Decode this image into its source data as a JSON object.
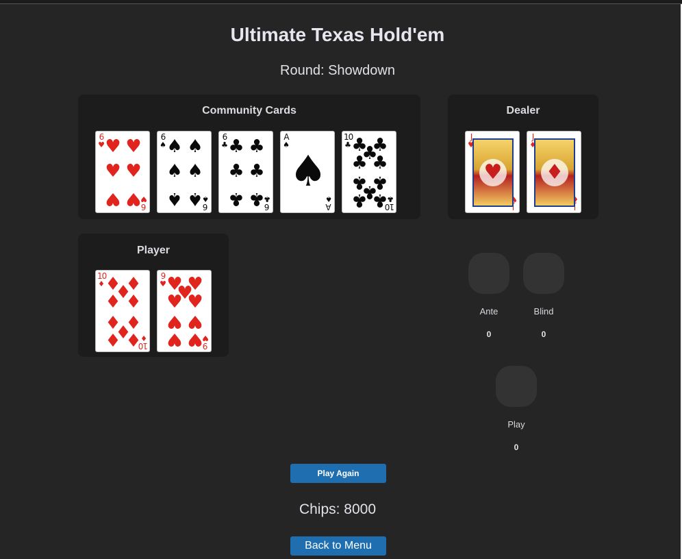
{
  "title": "Ultimate Texas Hold'em",
  "round_text": "Round: Showdown",
  "community": {
    "title": "Community Cards",
    "cards": [
      {
        "rank": "6",
        "suit": "hearts"
      },
      {
        "rank": "6",
        "suit": "spades"
      },
      {
        "rank": "6",
        "suit": "clubs"
      },
      {
        "rank": "A",
        "suit": "spades"
      },
      {
        "rank": "10",
        "suit": "clubs"
      }
    ]
  },
  "dealer": {
    "title": "Dealer",
    "cards": [
      {
        "rank": "J",
        "suit": "hearts"
      },
      {
        "rank": "J",
        "suit": "diamonds"
      }
    ]
  },
  "player": {
    "title": "Player",
    "cards": [
      {
        "rank": "10",
        "suit": "diamonds"
      },
      {
        "rank": "9",
        "suit": "hearts"
      }
    ]
  },
  "bets": {
    "ante": {
      "label": "Ante",
      "value": "0"
    },
    "blind": {
      "label": "Blind",
      "value": "0"
    },
    "play": {
      "label": "Play",
      "value": "0"
    }
  },
  "buttons": {
    "play_again": "Play Again",
    "back_to_menu": "Back to Menu"
  },
  "chips_text": "Chips: 8000",
  "colors": {
    "background": "#252525",
    "panel": "#1c1c1c",
    "button": "#1f6fb0",
    "red_suit": "#e0241e",
    "black_suit": "#0a0a0a"
  }
}
